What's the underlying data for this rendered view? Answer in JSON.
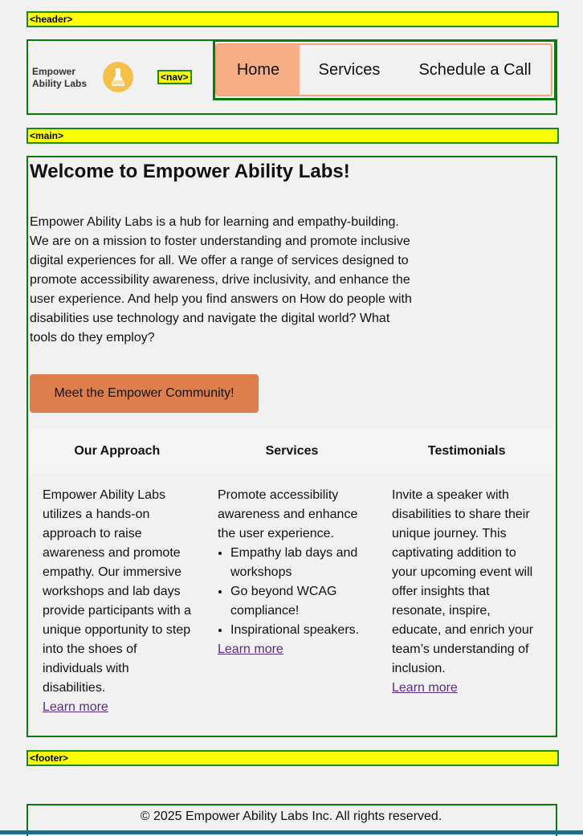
{
  "tags": {
    "header": "<header>",
    "nav": "<nav>",
    "main": "<main>",
    "footer": "<footer>"
  },
  "logo": {
    "text": "Empower Ability Labs",
    "icon": "flask-icon"
  },
  "nav": {
    "items": [
      {
        "label": "Home",
        "active": true
      },
      {
        "label": "Services"
      },
      {
        "label": "Schedule a Call"
      }
    ]
  },
  "main": {
    "title": "Welcome to Empower Ability Labs!",
    "intro": "Empower Ability Labs is a hub for learning and empathy-building. We are on a mission to foster understanding and promote inclusive digital experiences for all. We offer a range of services designed to promote accessibility awareness, drive inclusivity, and enhance the user experience. And help you find answers on How do people with disabilities use technology and navigate the digital world? What tools do they employ?",
    "cta_label": "Meet the Empower Community!",
    "tabs": [
      "Our Approach",
      "Services",
      "Testimonials"
    ],
    "approach": {
      "text": "Empower Ability Labs utilizes a hands-on approach to raise awareness and promote empathy. Our immersive workshops and lab days provide participants with a unique opportunity to step into the shoes of individuals with disabilities.",
      "link": "Learn more"
    },
    "services": {
      "text": "Promote accessibility awareness and enhance the user experience.",
      "items": [
        "Empathy lab days and workshops",
        "Go beyond WCAG compliance!",
        "Inspirational speakers."
      ],
      "link": "Learn more"
    },
    "testimonials": {
      "text": "Invite a speaker with disabilities to share their unique journey. This captivating addition to your upcoming event will offer insights that resonate, inspire, educate, and enrich your team’s understanding of inclusion.",
      "link": "Learn more"
    }
  },
  "footer": {
    "copyright": "© 2025 Empower Ability Labs Inc. All rights reserved."
  },
  "colors": {
    "tag_bg": "#ffff00",
    "outline": "#0a7a0a",
    "nav_active": "#f9af86",
    "cta": "#dc7f4c",
    "link": "#5a2d82"
  }
}
